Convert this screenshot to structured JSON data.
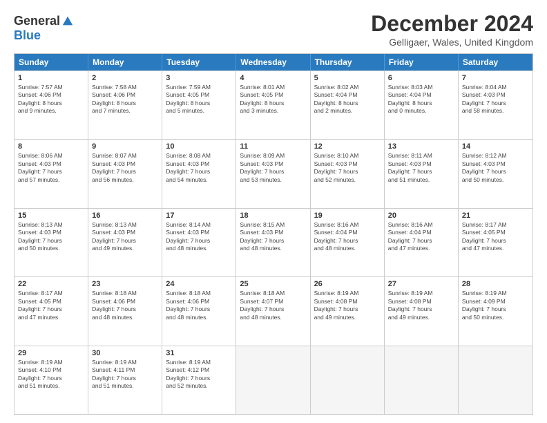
{
  "logo": {
    "general": "General",
    "blue": "Blue"
  },
  "title": "December 2024",
  "subtitle": "Gelligaer, Wales, United Kingdom",
  "header_days": [
    "Sunday",
    "Monday",
    "Tuesday",
    "Wednesday",
    "Thursday",
    "Friday",
    "Saturday"
  ],
  "weeks": [
    [
      {
        "day": "1",
        "info": "Sunrise: 7:57 AM\nSunset: 4:06 PM\nDaylight: 8 hours\nand 9 minutes."
      },
      {
        "day": "2",
        "info": "Sunrise: 7:58 AM\nSunset: 4:06 PM\nDaylight: 8 hours\nand 7 minutes."
      },
      {
        "day": "3",
        "info": "Sunrise: 7:59 AM\nSunset: 4:05 PM\nDaylight: 8 hours\nand 5 minutes."
      },
      {
        "day": "4",
        "info": "Sunrise: 8:01 AM\nSunset: 4:05 PM\nDaylight: 8 hours\nand 3 minutes."
      },
      {
        "day": "5",
        "info": "Sunrise: 8:02 AM\nSunset: 4:04 PM\nDaylight: 8 hours\nand 2 minutes."
      },
      {
        "day": "6",
        "info": "Sunrise: 8:03 AM\nSunset: 4:04 PM\nDaylight: 8 hours\nand 0 minutes."
      },
      {
        "day": "7",
        "info": "Sunrise: 8:04 AM\nSunset: 4:03 PM\nDaylight: 7 hours\nand 58 minutes."
      }
    ],
    [
      {
        "day": "8",
        "info": "Sunrise: 8:06 AM\nSunset: 4:03 PM\nDaylight: 7 hours\nand 57 minutes."
      },
      {
        "day": "9",
        "info": "Sunrise: 8:07 AM\nSunset: 4:03 PM\nDaylight: 7 hours\nand 56 minutes."
      },
      {
        "day": "10",
        "info": "Sunrise: 8:08 AM\nSunset: 4:03 PM\nDaylight: 7 hours\nand 54 minutes."
      },
      {
        "day": "11",
        "info": "Sunrise: 8:09 AM\nSunset: 4:03 PM\nDaylight: 7 hours\nand 53 minutes."
      },
      {
        "day": "12",
        "info": "Sunrise: 8:10 AM\nSunset: 4:03 PM\nDaylight: 7 hours\nand 52 minutes."
      },
      {
        "day": "13",
        "info": "Sunrise: 8:11 AM\nSunset: 4:03 PM\nDaylight: 7 hours\nand 51 minutes."
      },
      {
        "day": "14",
        "info": "Sunrise: 8:12 AM\nSunset: 4:03 PM\nDaylight: 7 hours\nand 50 minutes."
      }
    ],
    [
      {
        "day": "15",
        "info": "Sunrise: 8:13 AM\nSunset: 4:03 PM\nDaylight: 7 hours\nand 50 minutes."
      },
      {
        "day": "16",
        "info": "Sunrise: 8:13 AM\nSunset: 4:03 PM\nDaylight: 7 hours\nand 49 minutes."
      },
      {
        "day": "17",
        "info": "Sunrise: 8:14 AM\nSunset: 4:03 PM\nDaylight: 7 hours\nand 48 minutes."
      },
      {
        "day": "18",
        "info": "Sunrise: 8:15 AM\nSunset: 4:03 PM\nDaylight: 7 hours\nand 48 minutes."
      },
      {
        "day": "19",
        "info": "Sunrise: 8:16 AM\nSunset: 4:04 PM\nDaylight: 7 hours\nand 48 minutes."
      },
      {
        "day": "20",
        "info": "Sunrise: 8:16 AM\nSunset: 4:04 PM\nDaylight: 7 hours\nand 47 minutes."
      },
      {
        "day": "21",
        "info": "Sunrise: 8:17 AM\nSunset: 4:05 PM\nDaylight: 7 hours\nand 47 minutes."
      }
    ],
    [
      {
        "day": "22",
        "info": "Sunrise: 8:17 AM\nSunset: 4:05 PM\nDaylight: 7 hours\nand 47 minutes."
      },
      {
        "day": "23",
        "info": "Sunrise: 8:18 AM\nSunset: 4:06 PM\nDaylight: 7 hours\nand 48 minutes."
      },
      {
        "day": "24",
        "info": "Sunrise: 8:18 AM\nSunset: 4:06 PM\nDaylight: 7 hours\nand 48 minutes."
      },
      {
        "day": "25",
        "info": "Sunrise: 8:18 AM\nSunset: 4:07 PM\nDaylight: 7 hours\nand 48 minutes."
      },
      {
        "day": "26",
        "info": "Sunrise: 8:19 AM\nSunset: 4:08 PM\nDaylight: 7 hours\nand 49 minutes."
      },
      {
        "day": "27",
        "info": "Sunrise: 8:19 AM\nSunset: 4:08 PM\nDaylight: 7 hours\nand 49 minutes."
      },
      {
        "day": "28",
        "info": "Sunrise: 8:19 AM\nSunset: 4:09 PM\nDaylight: 7 hours\nand 50 minutes."
      }
    ],
    [
      {
        "day": "29",
        "info": "Sunrise: 8:19 AM\nSunset: 4:10 PM\nDaylight: 7 hours\nand 51 minutes."
      },
      {
        "day": "30",
        "info": "Sunrise: 8:19 AM\nSunset: 4:11 PM\nDaylight: 7 hours\nand 51 minutes."
      },
      {
        "day": "31",
        "info": "Sunrise: 8:19 AM\nSunset: 4:12 PM\nDaylight: 7 hours\nand 52 minutes."
      },
      {
        "day": "",
        "info": ""
      },
      {
        "day": "",
        "info": ""
      },
      {
        "day": "",
        "info": ""
      },
      {
        "day": "",
        "info": ""
      }
    ]
  ]
}
